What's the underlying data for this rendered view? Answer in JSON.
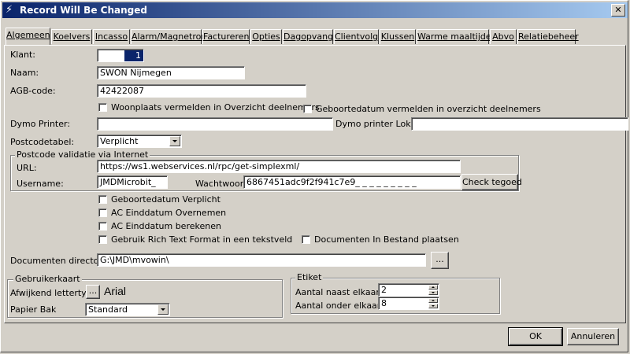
{
  "window": {
    "title": "Record Will Be Changed",
    "close_label": "✕"
  },
  "tabs": [
    "Algemeen",
    "Koelvers",
    "Incasso",
    "Alarm/Magnetron",
    "Factureren",
    "Opties",
    "Dagopvang",
    "Clientvolg",
    "Klussen",
    "Warme maaltijden",
    "Abvo",
    "Relatiebeheer"
  ],
  "form": {
    "klant_label": "Klant:",
    "klant_value": "1",
    "naam_label": "Naam:",
    "naam_value": "SWON Nijmegen",
    "agb_label": "AGB-code:",
    "agb_value": "42422087",
    "woonplaats_label": "Woonplaats vermelden in Overzicht deelnemers",
    "geboortedatum_label": "Geboortedatum  vermelden in overzicht deelnemers",
    "dymo_label": "Dymo Printer:",
    "dymo_value": "",
    "dymo_lokaal_label": "Dymo printer Lokaal",
    "dymo_lokaal_value": "",
    "postcodetabel_label": "Postcodetabel:",
    "postcodetabel_value": "Verplicht"
  },
  "postcode_group": {
    "title": "Postcode validatie via Internet",
    "url_label": "URL:",
    "url_value": "https://ws1.webservices.nl/rpc/get-simplexml/",
    "username_label": "Username:",
    "username_value": "JMDMicrobit_",
    "wachtwoord_label": "Wachtwoord:",
    "wachtwoord_value": "6867451adc9f2f941c7e9_ _ _ _ _ _ _ _ _",
    "check_button": "Check tegoed"
  },
  "checks": {
    "geboortedatum_verplicht": "Geboortedatum Verplicht",
    "ac_einddatum_overnemen": "AC Einddatum Overnemen",
    "ac_einddatum_berekenen": "AC Einddatum berekenen",
    "rich_text": "Gebruik Rich Text Format in een tekstveld",
    "documenten_bestand": "Documenten In Bestand plaatsen"
  },
  "documenten": {
    "label": "Documenten directory:",
    "value": "G:\\JMD\\mvowin\\",
    "browse": "..."
  },
  "gebruikerkaart": {
    "title": "Gebruikerkaart",
    "lettertype_label": "Afwijkend lettertype",
    "lettertype_button": "...",
    "font_preview": "Arial",
    "papier_label": "Papier Bak",
    "papier_value": "Standard"
  },
  "etiket": {
    "title": "Etiket",
    "naast_label": "Aantal naast elkaar",
    "naast_value": "2",
    "onder_label": "Aantal onder elkaar",
    "onder_value": "8"
  },
  "buttons": {
    "ok": "OK",
    "cancel": "Annuleren"
  }
}
